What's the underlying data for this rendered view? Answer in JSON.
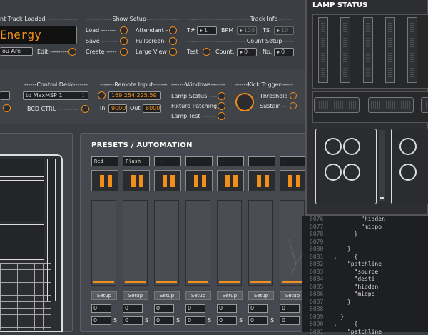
{
  "track_loaded": {
    "header": "nt Track Loaded----------------",
    "title": "Energy",
    "artist": "ou Are",
    "edit_label": "Edit ---------"
  },
  "show_setup": {
    "header": "-------------Show Setup-----------------",
    "load": "Load -------",
    "save": "Save --------",
    "create": "Create -----",
    "attendant": "Attendant -",
    "fullscreen": "Fullscreen-",
    "large_view": "Large View"
  },
  "track_info": {
    "header": "-------------------------------Track Info-------",
    "t_label": "T#",
    "t_value": "1",
    "bpm_label": "BPM",
    "bpm_value": "120",
    "ts_label": "TS",
    "ts_value": "10"
  },
  "count_setup": {
    "header": "-----------------------------Count Setup------",
    "test_label": "Test",
    "count_label": "Count:",
    "count_value": "0",
    "no_label": "No.",
    "no_value": "0"
  },
  "control_desk": {
    "header": "------Control Desk-------",
    "device": "to MaxMSP 1",
    "bcd_label": "BCD CTRL ----------"
  },
  "remote_input": {
    "header": "-------Remote Input-------",
    "ip": "169.254.225.59",
    "in_label": "In",
    "in_value": "9000",
    "out_label": "Out",
    "out_value": "8000"
  },
  "windows": {
    "header": "-------Windows-------",
    "lamp_status": "Lamp Status ----",
    "fixture_patching": "Fixture Patching",
    "lamp_test": "Lamp Test -------"
  },
  "kick_trigger": {
    "header": "------Kick Trigger------",
    "threshold": "Threshold",
    "sustain": "Sustain --"
  },
  "presets": {
    "title": "PRESETS / AUTOMATION",
    "setup_label": "Setup",
    "s_label": "S",
    "items": [
      {
        "name": "Red",
        "val1": "0",
        "val2": "0"
      },
      {
        "name": "Flash",
        "val1": "0",
        "val2": "0"
      },
      {
        "name": "--",
        "val1": "0",
        "val2": "0"
      },
      {
        "name": "--",
        "val1": "0",
        "val2": "0"
      },
      {
        "name": "--",
        "val1": "0",
        "val2": "0"
      },
      {
        "name": "--",
        "val1": "0",
        "val2": "0"
      },
      {
        "name": "--",
        "val1": "0",
        "val2": "0"
      }
    ]
  },
  "lamp_status": {
    "title": "LAMP STATUS"
  },
  "code": {
    "lines": [
      {
        "n": "6076",
        "t": "          \"hidden"
      },
      {
        "n": "6077",
        "t": "          \"midpo"
      },
      {
        "n": "6078",
        "t": "        }"
      },
      {
        "n": "6079",
        "t": ""
      },
      {
        "n": "6080",
        "t": "      }"
      },
      {
        "n": "6081",
        "t": "  ,     {"
      },
      {
        "n": "6082",
        "t": "      \"patchline"
      },
      {
        "n": "6083",
        "t": "        \"source"
      },
      {
        "n": "6084",
        "t": "        \"desti"
      },
      {
        "n": "6085",
        "t": "        \"hidden"
      },
      {
        "n": "6086",
        "t": "        \"midpo"
      },
      {
        "n": "6087",
        "t": "      }"
      },
      {
        "n": "6088",
        "t": ""
      },
      {
        "n": "6089",
        "t": "    }"
      },
      {
        "n": "6090",
        "t": "  ,     {"
      },
      {
        "n": "6091",
        "t": "      \"patchline"
      }
    ]
  },
  "colors": {
    "accent": "#f08c1a",
    "bg": "#3a3d42",
    "panel": "#45484e"
  }
}
